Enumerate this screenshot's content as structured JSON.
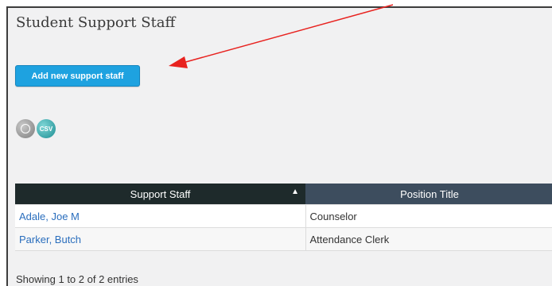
{
  "page": {
    "title": "Student Support Staff"
  },
  "toolbar": {
    "add_label": "Add new support staff"
  },
  "export": {
    "print_icon": "print-icon",
    "csv_label": "CSV"
  },
  "table": {
    "columns": [
      "Support Staff",
      "Position Title"
    ],
    "sort_indicator": "▲",
    "rows": [
      {
        "name": "Adale, Joe M",
        "position": "Counselor"
      },
      {
        "name": "Parker, Butch",
        "position": "Attendance Clerk"
      }
    ],
    "info": "Showing 1 to 2 of 2 entries"
  },
  "colors": {
    "button_blue": "#1ea2e0",
    "header_dark": "#1e2a2b",
    "header_slate": "#3d4d5e",
    "link_blue": "#2a6ebd",
    "annotation_arrow": "#e8221f"
  }
}
